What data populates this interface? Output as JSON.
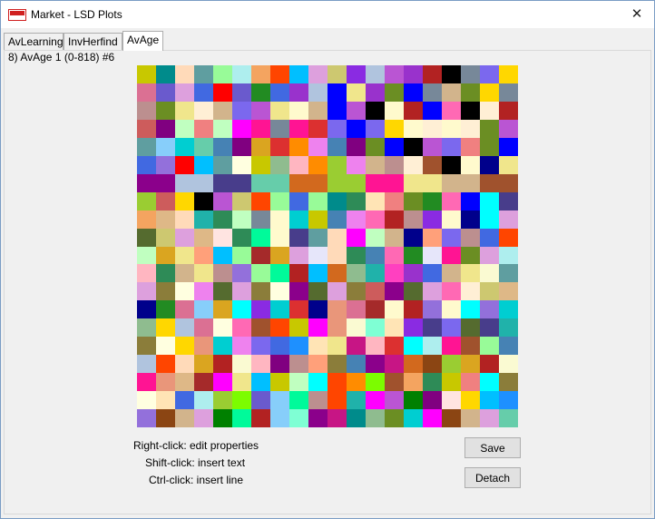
{
  "window": {
    "title": "Market - LSD Plots",
    "close_glyph": "✕",
    "app_icon": "lsd-logo-icon"
  },
  "tabs": [
    {
      "label": "AvLearning",
      "active": false
    },
    {
      "label": "InvHerfind",
      "active": false
    },
    {
      "label": "AvAge",
      "active": true
    }
  ],
  "plot": {
    "label": "8) AvAge 1 (0-818) #6",
    "rows": 20,
    "cols": 20
  },
  "hints": {
    "right_click": "Right-click: edit properties",
    "shift_click": "Shift-click: insert text",
    "ctrl_click": "Ctrl-click: insert line"
  },
  "buttons": {
    "save": "Save",
    "detach": "Detach"
  }
}
